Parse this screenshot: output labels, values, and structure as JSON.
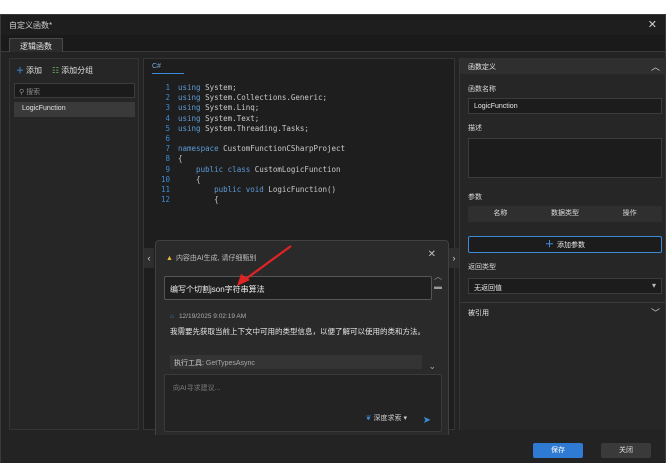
{
  "window": {
    "title": "自定义函数*",
    "close_icon": "close-icon"
  },
  "tabs": [
    {
      "label": "逻辑函数"
    }
  ],
  "left": {
    "add_label": "添加",
    "add_group_label": "添加分组",
    "search_placeholder": "搜索",
    "functions": [
      "LogicFunction"
    ]
  },
  "editor": {
    "language": "C#",
    "lines": [
      {
        "n": "1",
        "kw": "using",
        "rest": " System;"
      },
      {
        "n": "2",
        "kw": "using",
        "rest": " System.Collections.Generic;"
      },
      {
        "n": "3",
        "kw": "using",
        "rest": " System.Linq;"
      },
      {
        "n": "4",
        "kw": "using",
        "rest": " System.Text;"
      },
      {
        "n": "5",
        "kw": "using",
        "rest": " System.Threading.Tasks;"
      },
      {
        "n": "6",
        "kw": "",
        "rest": ""
      },
      {
        "n": "7",
        "kw": "namespace",
        "rest": " CustomFunctionCSharpProject"
      },
      {
        "n": "8",
        "kw": "",
        "rest": "{"
      },
      {
        "n": "9",
        "kw": "    public class",
        "rest": " CustomLogicFunction"
      },
      {
        "n": "10",
        "kw": "",
        "rest": "    {"
      },
      {
        "n": "11",
        "kw": "        public void",
        "rest": " LogicFunction()"
      },
      {
        "n": "12",
        "kw": "",
        "rest": "        {"
      }
    ]
  },
  "chat": {
    "warning": "内容由AI生成, 请仔细甄别",
    "input_value": "编写个切割json字符串算法",
    "ai_timestamp": "12/19/2025 9:02:19 AM",
    "ai_message": "我需要先获取当前上下文中可用的类型信息，以便了解可以使用的类和方法。",
    "tool_prefix": "执行工具:",
    "tool_name": "GetTypesAsync",
    "request_placeholder": "向AI寻求建议...",
    "mode_label": "深度求索"
  },
  "right": {
    "header": "函数定义",
    "name_label": "函数名称",
    "name_value": "LogicFunction",
    "desc_label": "描述",
    "params_label": "参数",
    "params_columns": [
      "名称",
      "数据类型",
      "操作"
    ],
    "add_param_label": "添加参数",
    "return_label": "返回类型",
    "return_value": "无返回值",
    "refs_label": "被引用"
  },
  "footer": {
    "save_label": "保存",
    "close_label": "关闭"
  },
  "colors": {
    "accent": "#3b8bd6",
    "arrow": "#e02424",
    "save": "#2f7ad2"
  }
}
